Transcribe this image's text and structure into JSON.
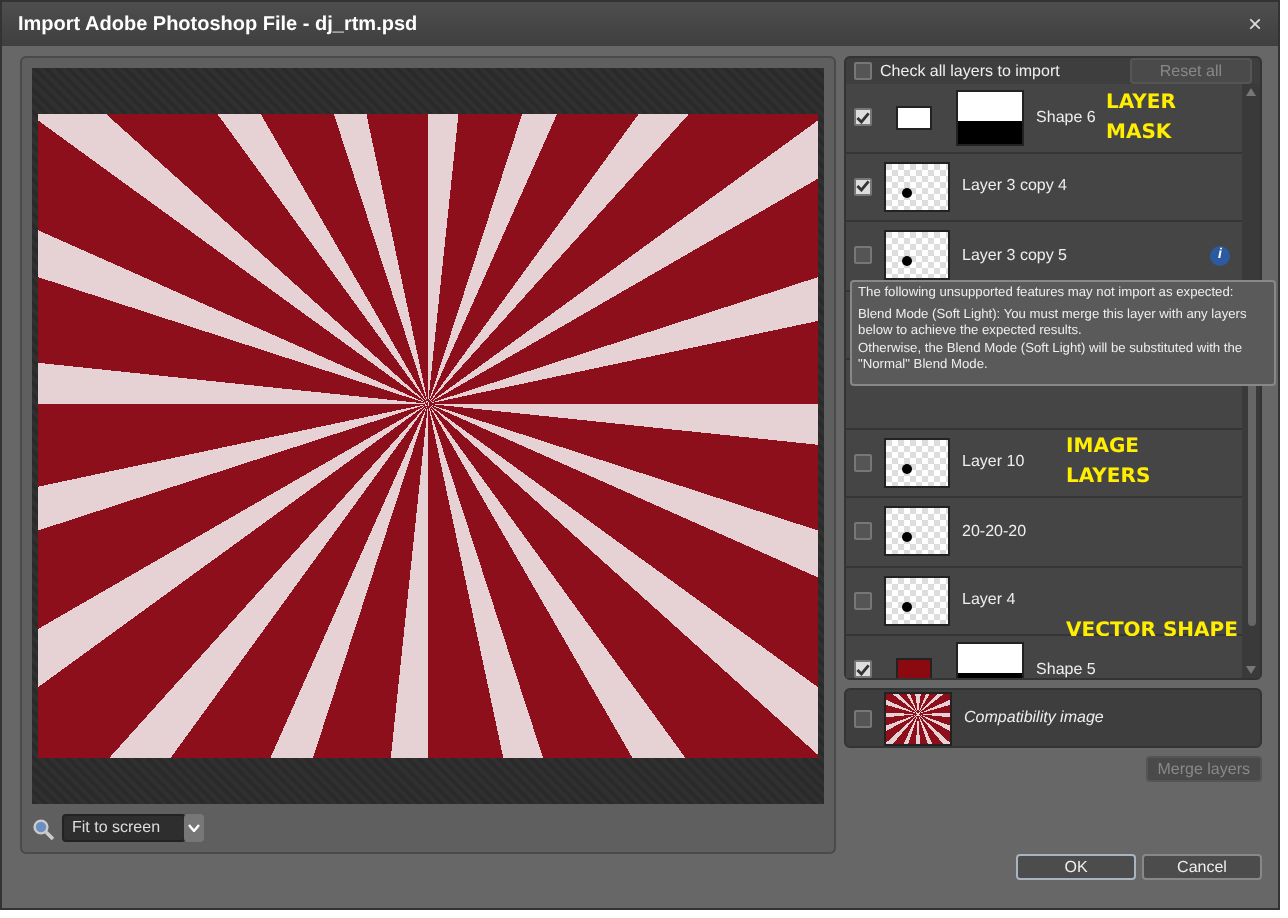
{
  "window": {
    "title": "Import Adobe Photoshop File - dj_rtm.psd",
    "close": "×"
  },
  "preview": {
    "zoom": "Fit to screen"
  },
  "check_all": {
    "label": "Check all layers to import",
    "checked": false
  },
  "reset_button": {
    "label": "Reset all",
    "disabled": true
  },
  "layers": [
    {
      "kind": "shape",
      "name": "Shape 6",
      "checked": true,
      "color": "#ffffff",
      "callout": "LAYER\nMASK"
    },
    {
      "kind": "image",
      "name": "Layer 3 copy 4",
      "checked": true
    },
    {
      "kind": "image",
      "name": "Layer 3 copy 5",
      "checked": false,
      "info": "i"
    },
    {
      "kind": "image",
      "name": "Layer 10",
      "checked": false,
      "callout": "IMAGE\nLAYERS"
    },
    {
      "kind": "image",
      "name": "20-20-20",
      "checked": false
    },
    {
      "kind": "image",
      "name": "Layer 4",
      "checked": false,
      "callout": "VECTOR SHAPE"
    },
    {
      "kind": "shape",
      "name": "Shape 5",
      "checked": true,
      "color": "#8b0a10"
    }
  ],
  "tooltip": {
    "heading": "The following unsupported features may not import as expected:",
    "body": "Blend Mode (Soft Light): You must merge this layer with any layers below to achieve the expected results.\nOtherwise, the Blend Mode (Soft Light) will be substituted with the \"Normal\" Blend Mode."
  },
  "compatibility": {
    "label": "Compatibility image",
    "checked": false
  },
  "merge_button": {
    "label": "Merge layers",
    "disabled": true
  },
  "buttons": [
    {
      "label": "OK",
      "kind": "default"
    },
    {
      "label": "Cancel",
      "kind": "normal"
    }
  ]
}
